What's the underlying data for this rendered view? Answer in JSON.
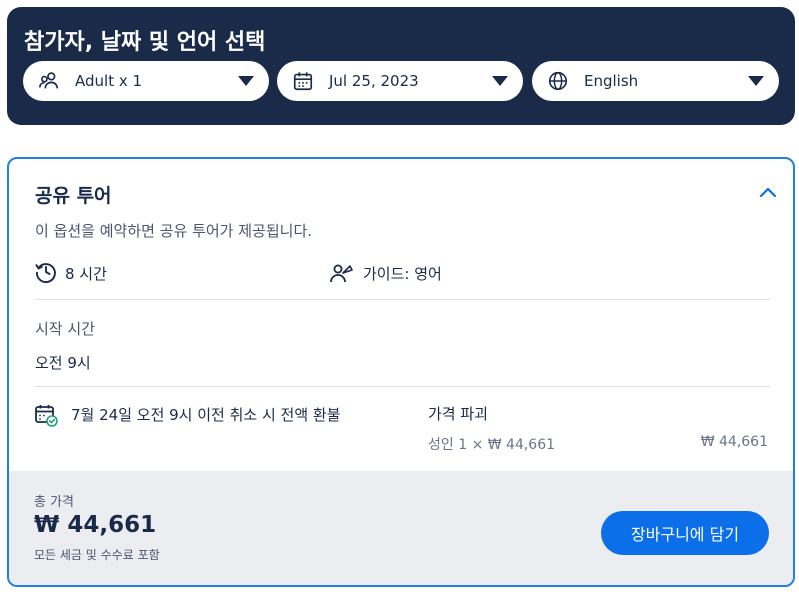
{
  "header": {
    "title": "참가자, 날짜 및 언어 선택",
    "participants": {
      "label": "Adult x 1",
      "icon": "people-icon"
    },
    "date": {
      "label": "Jul 25, 2023",
      "icon": "calendar-icon"
    },
    "language": {
      "label": "English",
      "icon": "globe-icon"
    }
  },
  "option": {
    "title": "공유 투어",
    "description": "이 옵션을 예약하면 공유 투어가 제공됩니다.",
    "duration": "8 시간",
    "guide": "가이드: 영어",
    "start_time_label": "시작 시간",
    "start_time_value": "오전 9시",
    "cancellation": "7월 24일 오전 9시 이전 취소 시 전액 환불",
    "price_breakdown_label": "가격 파괴",
    "price_line_label": "성인 1 × ₩ 44,661",
    "price_line_value": "₩ 44,661"
  },
  "footer": {
    "total_label": "총 가격",
    "total_value": "₩ 44,661",
    "tax_note": "모든 세금 및 수수료 포함",
    "add_to_cart_label": "장바구니에 담기"
  },
  "colors": {
    "header_bg": "#1a2b49",
    "accent_blue": "#0a6fe8",
    "card_border": "#1f7fe6",
    "footer_bg": "#ebedf1",
    "check_green": "#1aa37a"
  }
}
